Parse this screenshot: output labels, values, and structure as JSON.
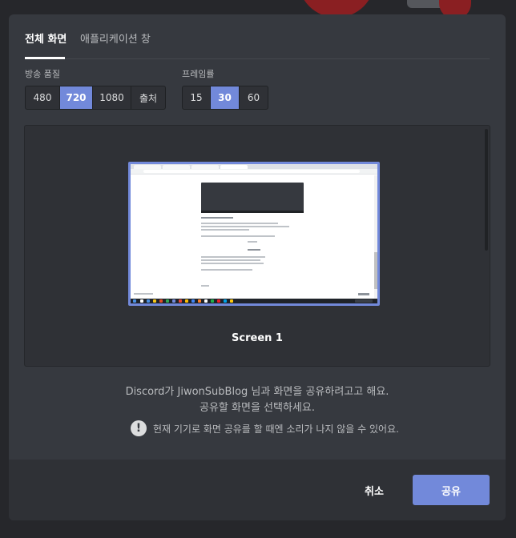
{
  "tabs": [
    {
      "label": "전체 화면",
      "active": true
    },
    {
      "label": "애플리케이션 창",
      "active": false
    }
  ],
  "quality": {
    "label": "방송 품질",
    "options": [
      "480",
      "720",
      "1080",
      "출처"
    ],
    "selected": "720"
  },
  "framerate": {
    "label": "프레임률",
    "options": [
      "15",
      "30",
      "60"
    ],
    "selected": "30"
  },
  "preview": {
    "screen_label": "Screen 1"
  },
  "info": {
    "line1": "Discord가 JiwonSubBlog 님과 화면을 공유하려고고 해요.",
    "line2": "공유할 화면을 선택하세요.",
    "warning": "현재 기기로 화면 공유를 할 때엔 소리가 나지 않을 수 있어요.",
    "warning_icon_glyph": "!"
  },
  "footer": {
    "cancel_label": "취소",
    "share_label": "공유"
  },
  "colors": {
    "accent": "#7289da",
    "modal_bg": "#36393f",
    "footer_bg": "#2f3136"
  }
}
